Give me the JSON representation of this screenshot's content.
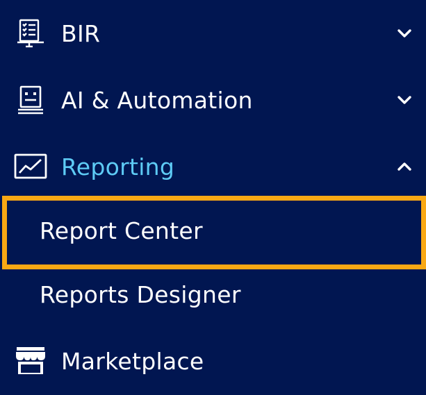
{
  "nav": {
    "bir": {
      "label": "BIR",
      "icon": "tax-form-icon",
      "chevron": "chevron-down-icon"
    },
    "ai": {
      "label": "AI & Automation",
      "icon": "robot-icon",
      "chevron": "chevron-down-icon"
    },
    "reporting": {
      "label": "Reporting",
      "icon": "line-chart-icon",
      "chevron": "chevron-up-icon",
      "expanded": true,
      "children": [
        {
          "label": "Report Center",
          "highlighted": true
        },
        {
          "label": "Reports Designer"
        }
      ]
    },
    "marketplace": {
      "label": "Marketplace",
      "icon": "storefront-icon"
    }
  },
  "colors": {
    "background": "#011651",
    "text": "#ffffff",
    "active": "#5ecbf5",
    "highlight_border": "#f9a814"
  }
}
